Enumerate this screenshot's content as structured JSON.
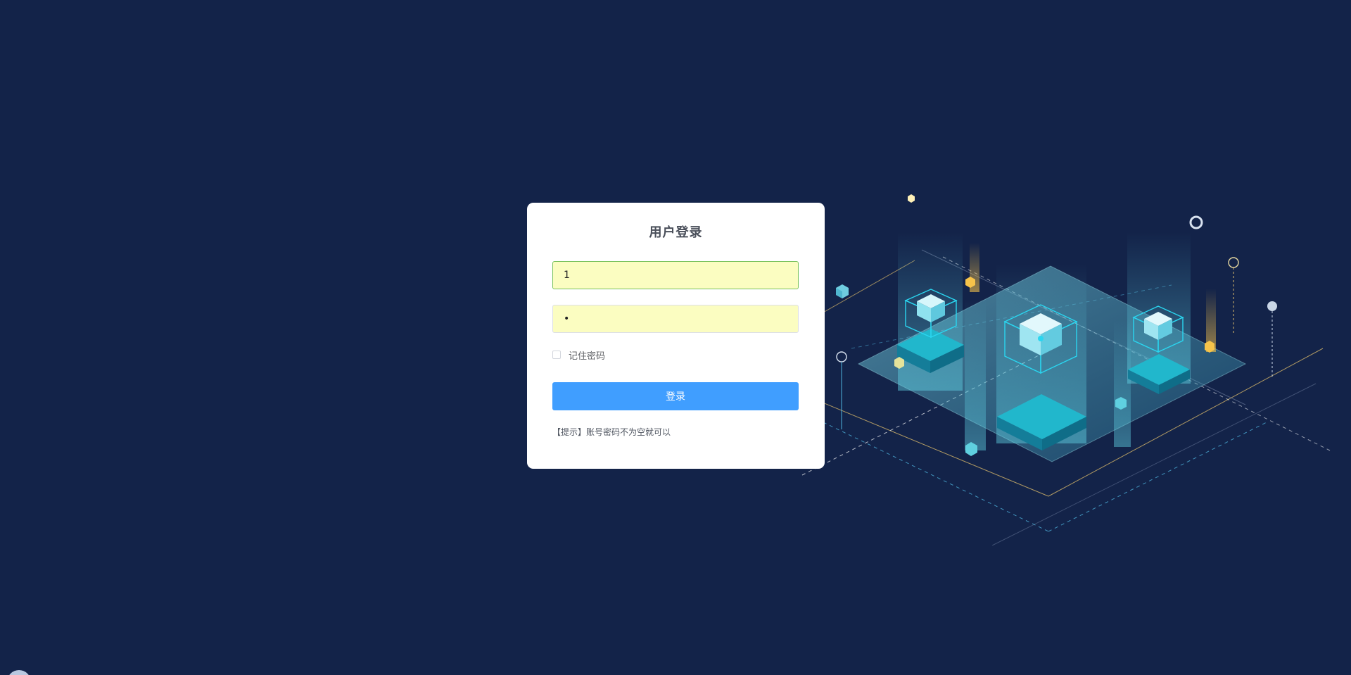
{
  "login": {
    "title": "用户登录",
    "username_value": "1",
    "password_value": "1",
    "remember_label": "记住密码",
    "remember_checked": false,
    "submit_label": "登录",
    "hint": "【提示】账号密码不为空就可以"
  },
  "colors": {
    "background": "#132349",
    "card": "#ffffff",
    "primary_button": "#409eff",
    "autofill_field": "#fbfdc1",
    "accent_teal": "#19c3d8",
    "accent_gold": "#f6c34a"
  }
}
